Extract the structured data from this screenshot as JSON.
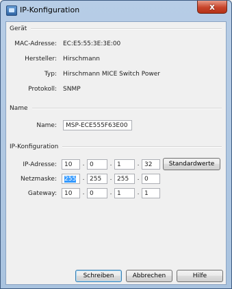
{
  "window": {
    "title": "IP-Konfiguration",
    "close_glyph": "x"
  },
  "geraet": {
    "header": "Gerät",
    "rows": [
      {
        "label": "MAC-Adresse:",
        "value": "EC:E5:55:3E:3E:00"
      },
      {
        "label": "Hersteller:",
        "value": "Hirschmann"
      },
      {
        "label": "Typ:",
        "value": "Hirschmann MICE Switch Power"
      },
      {
        "label": "Protokoll:",
        "value": "SNMP"
      }
    ]
  },
  "name_group": {
    "header": "Name",
    "label": "Name:",
    "value": "MSP-ECE555F63E00"
  },
  "ip_group": {
    "header": "IP-Konfiguration",
    "ip": {
      "label": "IP-Adresse:",
      "octets": [
        "10",
        "0",
        "1",
        "32"
      ]
    },
    "mask": {
      "label": "Netzmaske:",
      "octets": [
        "255",
        "255",
        "255",
        "0"
      ]
    },
    "gateway": {
      "label": "Gateway:",
      "octets": [
        "10",
        "0",
        "1",
        "1"
      ]
    },
    "defaults_button": "Standardwerte"
  },
  "buttons": {
    "write": "Schreiben",
    "cancel": "Abbrechen",
    "help": "Hilfe"
  },
  "dot_char": "."
}
